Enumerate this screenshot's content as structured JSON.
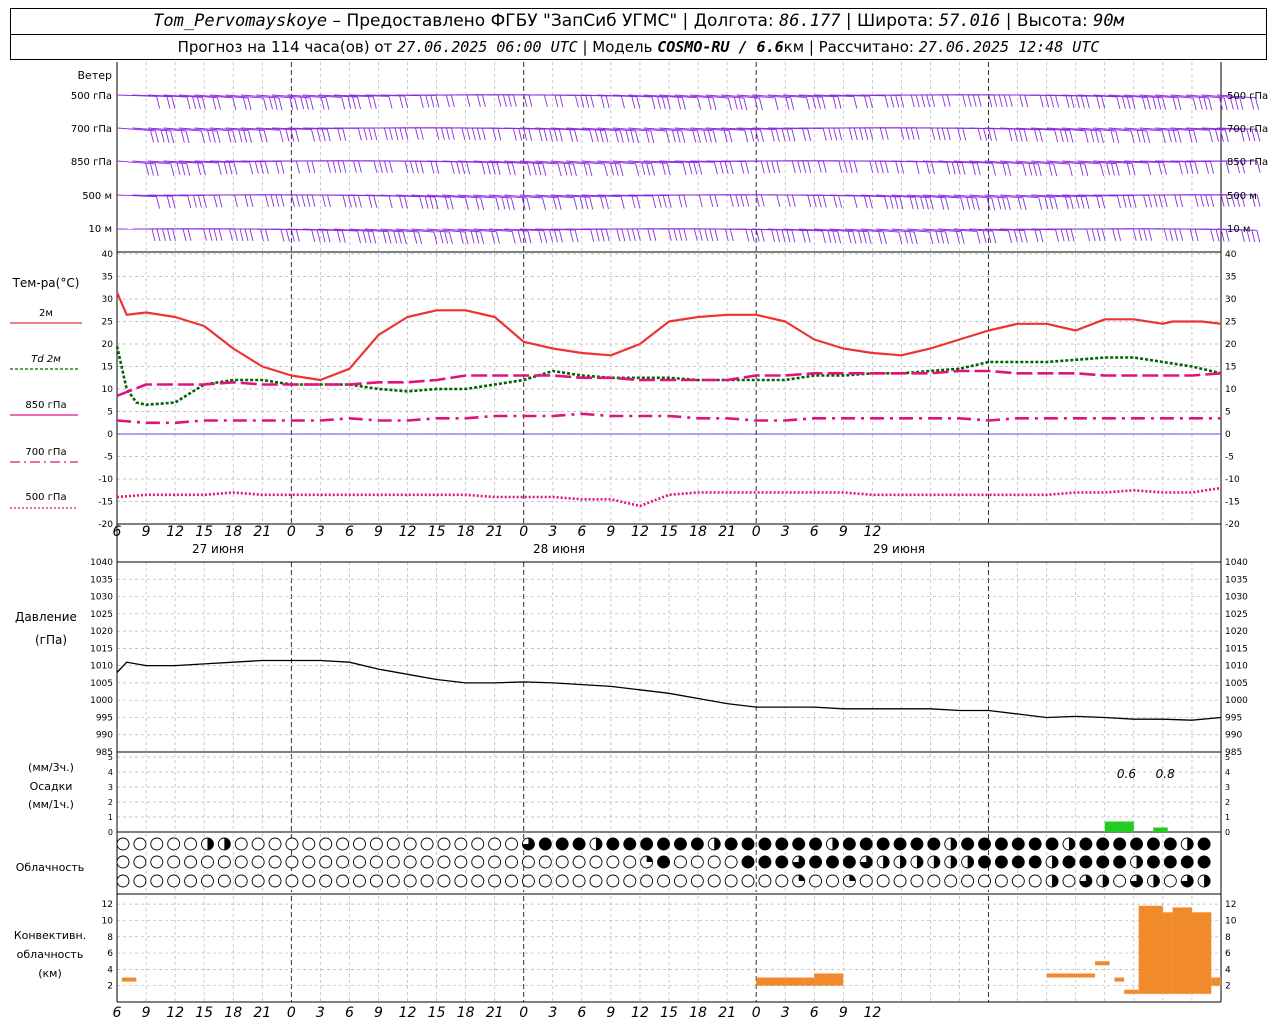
{
  "header": {
    "station": "Tom_Pervomayskoye",
    "provider": "– Предоставлено ФГБУ \"ЗапСиб УГМС\"",
    "lon_label": "Долгота:",
    "lon_value": "86.177",
    "lat_label": "Широта:",
    "lat_value": "57.016",
    "alt_label": "Высота:",
    "alt_value": "90м",
    "forecast_label": "Прогноз на 114 часа(ов) от",
    "forecast_start": "27.06.2025 06:00 UTC",
    "model_label": "Модель",
    "model_name": "COSMO-RU / 6.6",
    "model_res_unit": "км",
    "calc_label": "Рассчитано:",
    "calc_time": "27.06.2025 12:48 UTC"
  },
  "labels": {
    "wind_title": "Ветер",
    "wind_levels": [
      "500 гПа",
      "700 гПа",
      "850 гПа",
      "500  м",
      "10   м"
    ],
    "temp_title": "Тем-ра(°C)",
    "temp_legend": [
      "2м",
      "Td  2м",
      "850 гПа",
      "700 гПа",
      "500 гПа"
    ],
    "pressure_title": "Давление",
    "pressure_unit": "(гПа)",
    "precip_unit_top": "(мм/3ч.)",
    "precip_title": "Осадки",
    "precip_unit_bottom": "(мм/1ч.)",
    "cloud_title": "Облачность",
    "conv_title_1": "Конвективн.",
    "conv_title_2": "облачность",
    "conv_unit": "(км)",
    "date_labels": [
      "27 июня",
      "28 июня",
      "29 июня"
    ]
  },
  "colors": {
    "wind": "#8a2be2",
    "t2m": "#ee3333",
    "td2m": "#006400",
    "t850": "#e0127f",
    "t700": "#e0127f",
    "t500": "#e0127f",
    "zero_line": "#2222dd",
    "pressure": "#000000",
    "precip": "#22cc22",
    "convective": "#f08a2a",
    "grid": "#b4b4b4",
    "day_line": "#000000"
  },
  "chart_data": [
    {
      "type": "line",
      "title": "Тем-ра(°C)",
      "x_hours_ticks": [
        "6",
        "9",
        "12",
        "15",
        "18",
        "21",
        "0",
        "3",
        "6",
        "9",
        "12",
        "15",
        "18",
        "21",
        "0",
        "3",
        "6",
        "9",
        "12",
        "15",
        "18",
        "21",
        "0",
        "3",
        "6",
        "9",
        "12"
      ],
      "ylim": [
        -20,
        40
      ],
      "yticks": [
        -20,
        -15,
        -10,
        -5,
        0,
        5,
        10,
        15,
        20,
        25,
        30,
        35,
        40
      ],
      "series": [
        {
          "name": "2м",
          "key": "t2m",
          "x_h": [
            0,
            1,
            3,
            6,
            9,
            12,
            15,
            18,
            21,
            24,
            27,
            30,
            33,
            36,
            39,
            42,
            45,
            48,
            51,
            54,
            57,
            60,
            63,
            66,
            69,
            72,
            75,
            78,
            81,
            84,
            87,
            90,
            93,
            96,
            99,
            102,
            105,
            108,
            109,
            111,
            112,
            114
          ],
          "y": [
            31.5,
            26.5,
            27,
            26,
            24,
            19,
            15,
            13,
            12,
            14.5,
            22,
            26,
            27.5,
            27.5,
            26,
            20.5,
            19,
            18,
            17.5,
            20,
            25,
            26,
            26.5,
            26.5,
            25,
            21,
            19,
            18,
            17.5,
            19,
            21,
            23,
            24.5,
            24.5,
            23,
            25.5,
            25.5,
            24.5,
            25,
            25,
            25,
            24.5
          ]
        },
        {
          "name": "Td  2м",
          "key": "td2m",
          "x_h": [
            0,
            1,
            2,
            3,
            6,
            9,
            12,
            15,
            18,
            21,
            24,
            27,
            30,
            33,
            36,
            39,
            42,
            45,
            48,
            51,
            54,
            57,
            60,
            63,
            66,
            69,
            72,
            75,
            78,
            81,
            84,
            87,
            90,
            93,
            96,
            99,
            102,
            105,
            108,
            111,
            114
          ],
          "y": [
            19.5,
            10,
            7,
            6.5,
            7,
            11,
            12,
            12,
            11,
            11,
            11,
            10,
            9.5,
            10,
            10,
            11,
            12,
            14,
            13,
            12.5,
            12.5,
            12.5,
            12,
            12,
            12,
            12,
            13,
            13,
            13.5,
            13.5,
            14,
            14.5,
            16,
            16,
            16,
            16.5,
            17,
            17,
            16,
            15,
            13.5
          ]
        },
        {
          "name": "850 гПа",
          "key": "t850",
          "x_h": [
            0,
            3,
            6,
            9,
            12,
            15,
            18,
            21,
            24,
            27,
            30,
            33,
            36,
            39,
            42,
            45,
            48,
            51,
            54,
            57,
            60,
            63,
            66,
            69,
            72,
            75,
            78,
            81,
            84,
            87,
            90,
            93,
            96,
            99,
            102,
            105,
            108,
            111,
            114
          ],
          "y": [
            8.5,
            11,
            11,
            11,
            11.5,
            11,
            11,
            11,
            11,
            11.5,
            11.5,
            12,
            13,
            13,
            13,
            13,
            12.5,
            12.5,
            12,
            12,
            12,
            12,
            13,
            13,
            13.5,
            13.5,
            13.5,
            13.5,
            13.5,
            14,
            14,
            13.5,
            13.5,
            13.5,
            13,
            13,
            13,
            13,
            13.5
          ]
        },
        {
          "name": "700 гПа",
          "key": "t700",
          "x_h": [
            0,
            3,
            6,
            9,
            12,
            15,
            18,
            21,
            24,
            27,
            30,
            33,
            36,
            39,
            42,
            45,
            48,
            51,
            54,
            57,
            60,
            63,
            66,
            69,
            72,
            75,
            78,
            81,
            84,
            87,
            90,
            93,
            96,
            99,
            102,
            105,
            108,
            111,
            114
          ],
          "y": [
            3,
            2.5,
            2.5,
            3,
            3,
            3,
            3,
            3,
            3.5,
            3,
            3,
            3.5,
            3.5,
            4,
            4,
            4,
            4.5,
            4,
            4,
            4,
            3.5,
            3.5,
            3,
            3,
            3.5,
            3.5,
            3.5,
            3.5,
            3.5,
            3.5,
            3,
            3.5,
            3.5,
            3.5,
            3.5,
            3.5,
            3.5,
            3.5,
            3.5
          ]
        },
        {
          "name": "500 гПа",
          "key": "t500",
          "x_h": [
            0,
            3,
            6,
            9,
            12,
            15,
            18,
            21,
            24,
            27,
            30,
            33,
            36,
            39,
            42,
            45,
            48,
            51,
            54,
            57,
            60,
            63,
            66,
            69,
            72,
            75,
            78,
            81,
            84,
            87,
            90,
            93,
            96,
            99,
            102,
            105,
            108,
            111,
            114
          ],
          "y": [
            -14,
            -13.5,
            -13.5,
            -13.5,
            -13,
            -13.5,
            -13.5,
            -13.5,
            -13.5,
            -13.5,
            -13.5,
            -13.5,
            -13.5,
            -14,
            -14,
            -14,
            -14.5,
            -14.5,
            -16,
            -13.5,
            -13,
            -13,
            -13,
            -13,
            -13,
            -13,
            -13.5,
            -13.5,
            -13.5,
            -13.5,
            -13.5,
            -13.5,
            -13.5,
            -13,
            -13,
            -12.5,
            -13,
            -13,
            -12
          ]
        }
      ]
    },
    {
      "type": "line",
      "title": "Давление",
      "ylim": [
        985,
        1040
      ],
      "yticks": [
        985,
        990,
        995,
        1000,
        1005,
        1010,
        1015,
        1020,
        1025,
        1030,
        1035,
        1040
      ],
      "series": [
        {
          "name": "Давление",
          "key": "pressure",
          "x_h": [
            0,
            1,
            3,
            6,
            9,
            12,
            15,
            18,
            21,
            24,
            27,
            30,
            33,
            36,
            39,
            42,
            45,
            48,
            51,
            54,
            57,
            60,
            63,
            66,
            69,
            72,
            75,
            78,
            81,
            84,
            87,
            90,
            93,
            96,
            99,
            102,
            105,
            108,
            111,
            114
          ],
          "y": [
            1008,
            1011,
            1010,
            1010,
            1010.5,
            1011,
            1011.5,
            1011.5,
            1011.5,
            1011,
            1009,
            1007.5,
            1006,
            1005,
            1005,
            1005.3,
            1005,
            1004.5,
            1004,
            1003,
            1002,
            1000.5,
            999,
            998,
            998,
            998,
            997.5,
            997.5,
            997.5,
            997.5,
            997,
            997,
            996,
            995,
            995.3,
            995,
            994.5,
            994.5,
            994.2,
            995
          ]
        }
      ]
    },
    {
      "type": "bar",
      "title": "Осадки",
      "ylim": [
        0,
        5
      ],
      "yticks": [
        0,
        1,
        2,
        3,
        4,
        5
      ],
      "bars": [
        {
          "x_start_h": 102,
          "x_end_h": 105,
          "value": 0.7
        },
        {
          "x_start_h": 107,
          "x_end_h": 108.5,
          "value": 0.3
        }
      ],
      "annotations": [
        {
          "x_h": 103,
          "text": "0.6"
        },
        {
          "x_h": 107,
          "text": "0.8"
        }
      ]
    },
    {
      "type": "bar",
      "title": "Конвективн. облачность",
      "ylim": [
        0,
        13
      ],
      "yticks": [
        2,
        4,
        6,
        8,
        10,
        12
      ],
      "bars": [
        {
          "x_start_h": 0.5,
          "x_end_h": 2,
          "bottom": 2.5,
          "top": 3
        },
        {
          "x_start_h": 66,
          "x_end_h": 69,
          "bottom": 2,
          "top": 3
        },
        {
          "x_start_h": 69,
          "x_end_h": 71,
          "bottom": 2,
          "top": 3
        },
        {
          "x_start_h": 71,
          "x_end_h": 72,
          "bottom": 2,
          "top": 3
        },
        {
          "x_start_h": 72,
          "x_end_h": 75,
          "bottom": 2,
          "top": 3.5
        },
        {
          "x_start_h": 96,
          "x_end_h": 101,
          "bottom": 3,
          "top": 3.5
        },
        {
          "x_start_h": 101,
          "x_end_h": 102.5,
          "bottom": 4.5,
          "top": 5
        },
        {
          "x_start_h": 103,
          "x_end_h": 104,
          "bottom": 2.5,
          "top": 3
        },
        {
          "x_start_h": 104,
          "x_end_h": 105.5,
          "bottom": 1,
          "top": 1.5
        },
        {
          "x_start_h": 105.5,
          "x_end_h": 108,
          "bottom": 1,
          "top": 11.8
        },
        {
          "x_start_h": 108,
          "x_end_h": 109,
          "bottom": 1,
          "top": 11
        },
        {
          "x_start_h": 109,
          "x_end_h": 111,
          "bottom": 1,
          "top": 11.6
        },
        {
          "x_start_h": 111,
          "x_end_h": 113,
          "bottom": 1,
          "top": 11
        },
        {
          "x_start_h": 113,
          "x_end_h": 114,
          "bottom": 2,
          "top": 3
        }
      ]
    }
  ]
}
